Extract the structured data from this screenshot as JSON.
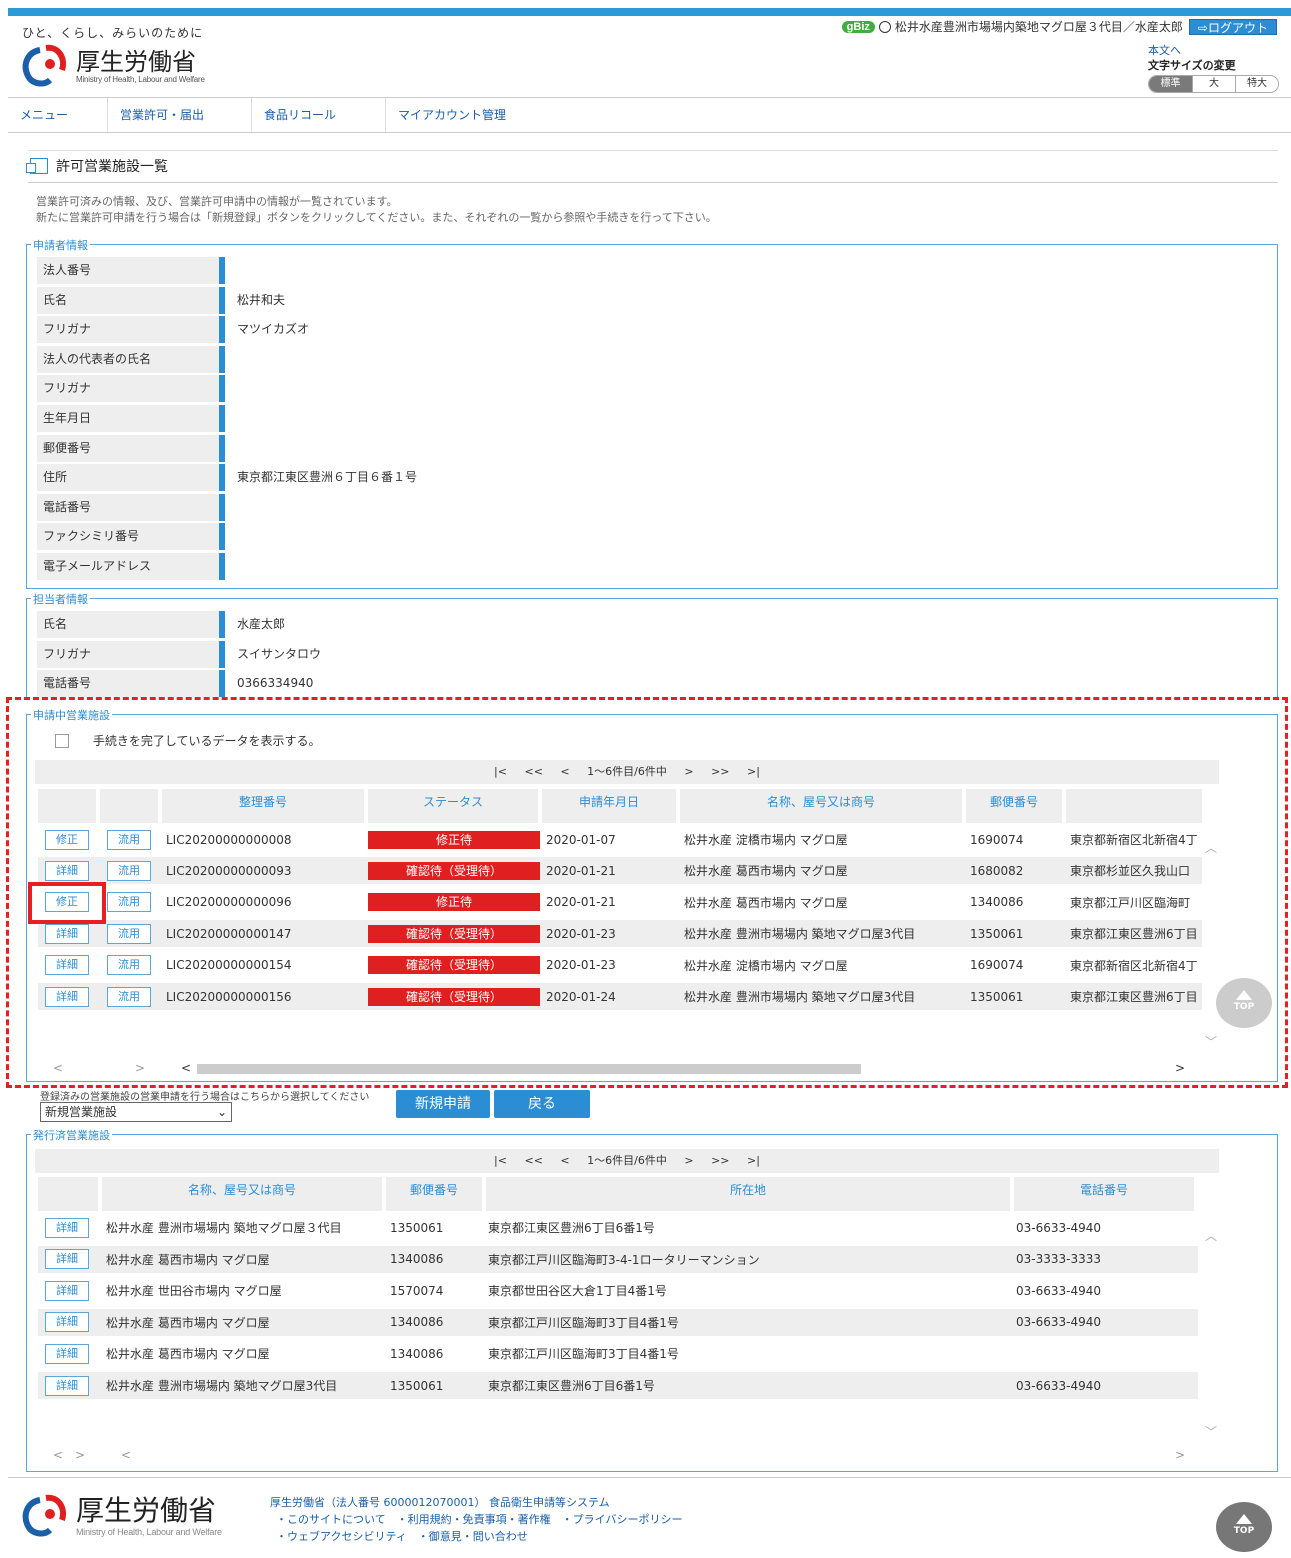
{
  "header": {
    "tagline": "ひと、くらし、みらいのために",
    "logo_ja": "厚生労働省",
    "logo_en": "Ministry of Health, Labour and Welfare",
    "gbiz": "gBiz",
    "user": "松井水産豊洲市場場内築地マグロ屋３代目／水産太郎",
    "logout": "ログアウト",
    "skip": "本文へ",
    "fontsize_label": "文字サイズの変更",
    "fontsize": [
      "標準",
      "大",
      "特大"
    ]
  },
  "nav": [
    "メニュー",
    "営業許可・届出",
    "食品リコール",
    "マイアカウント管理"
  ],
  "page": {
    "title": "許可営業施設一覧",
    "desc1": "営業許可済みの情報、及び、営業許可申請中の情報が一覧されています。",
    "desc2": "新たに営業許可申請を行う場合は「新規登録」ボタンをクリックしてください。また、それぞれの一覧から参照や手続きを行って下さい。"
  },
  "applicant": {
    "legend": "申請者情報",
    "rows": [
      {
        "label": "法人番号",
        "value": ""
      },
      {
        "label": "氏名",
        "value": "松井和夫"
      },
      {
        "label": "フリガナ",
        "value": "マツイカズオ"
      },
      {
        "label": "法人の代表者の氏名",
        "value": ""
      },
      {
        "label": "フリガナ",
        "value": ""
      },
      {
        "label": "生年月日",
        "value": ""
      },
      {
        "label": "郵便番号",
        "value": ""
      },
      {
        "label": "住所",
        "value": "東京都江東区豊洲６丁目６番１号"
      },
      {
        "label": "電話番号",
        "value": ""
      },
      {
        "label": "ファクシミリ番号",
        "value": ""
      },
      {
        "label": "電子メールアドレス",
        "value": ""
      }
    ]
  },
  "contact": {
    "legend": "担当者情報",
    "rows": [
      {
        "label": "氏名",
        "value": "水産太郎"
      },
      {
        "label": "フリガナ",
        "value": "スイサンタロウ"
      },
      {
        "label": "電話番号",
        "value": "0366334940"
      }
    ]
  },
  "pending": {
    "legend": "申請中営業施設",
    "checkbox_label": "手続きを完了しているデータを表示する。",
    "pager": [
      "|<",
      "<<",
      "<",
      "1〜6件目/6件中",
      ">",
      ">>",
      ">|"
    ],
    "headers": [
      "",
      "",
      "整理番号",
      "ステータス",
      "申請年月日",
      "名称、屋号又は商号",
      "郵便番号",
      ""
    ],
    "rows": [
      {
        "btn1": "修正",
        "btn2": "流用",
        "no": "LIC20200000000008",
        "status": "修正待",
        "date": "2020-01-07",
        "name": "松井水産 淀橋市場内 マグロ屋",
        "zip": "1690074",
        "addr": "東京都新宿区北新宿4丁"
      },
      {
        "btn1": "詳細",
        "btn2": "流用",
        "no": "LIC20200000000093",
        "status": "確認待（受理待）",
        "date": "2020-01-21",
        "name": "松井水産 葛西市場内 マグロ屋",
        "zip": "1680082",
        "addr": "東京都杉並区久我山口"
      },
      {
        "btn1": "修正",
        "btn2": "流用",
        "no": "LIC20200000000096",
        "status": "修正待",
        "date": "2020-01-21",
        "name": "松井水産 葛西市場内 マグロ屋",
        "zip": "1340086",
        "addr": "東京都江戸川区臨海町"
      },
      {
        "btn1": "詳細",
        "btn2": "流用",
        "no": "LIC20200000000147",
        "status": "確認待（受理待）",
        "date": "2020-01-23",
        "name": "松井水産 豊洲市場場内 築地マグロ屋3代目",
        "zip": "1350061",
        "addr": "東京都江東区豊洲6丁目"
      },
      {
        "btn1": "詳細",
        "btn2": "流用",
        "no": "LIC20200000000154",
        "status": "確認待（受理待）",
        "date": "2020-01-23",
        "name": "松井水産 淀橋市場内 マグロ屋",
        "zip": "1690074",
        "addr": "東京都新宿区北新宿4丁"
      },
      {
        "btn1": "詳細",
        "btn2": "流用",
        "no": "LIC20200000000156",
        "status": "確認待（受理待）",
        "date": "2020-01-24",
        "name": "松井水産 豊洲市場場内 築地マグロ屋3代目",
        "zip": "1350061",
        "addr": "東京都江東区豊洲6丁目"
      }
    ]
  },
  "actions": {
    "select_label": "登録済みの営業施設の営業申請を行う場合はこちらから選択してください",
    "select_value": "新規営業施設",
    "new_button": "新規申請",
    "back_button": "戻る",
    "top": "TOP"
  },
  "issued": {
    "legend": "発行済営業施設",
    "pager": [
      "|<",
      "<<",
      "<",
      "1〜6件目/6件中",
      ">",
      ">>",
      ">|"
    ],
    "headers": [
      "",
      "名称、屋号又は商号",
      "郵便番号",
      "所在地",
      "電話番号"
    ],
    "rows": [
      {
        "btn": "詳細",
        "name": "松井水産 豊洲市場場内 築地マグロ屋３代目",
        "zip": "1350061",
        "addr": "東京都江東区豊洲6丁目6番1号",
        "tel": "03-6633-4940"
      },
      {
        "btn": "詳細",
        "name": "松井水産 葛西市場内 マグロ屋",
        "zip": "1340086",
        "addr": "東京都江戸川区臨海町3-4-1ロータリーマンション",
        "tel": "03-3333-3333"
      },
      {
        "btn": "詳細",
        "name": "松井水産 世田谷市場内 マグロ屋",
        "zip": "1570074",
        "addr": "東京都世田谷区大倉1丁目4番1号",
        "tel": "03-6633-4940"
      },
      {
        "btn": "詳細",
        "name": "松井水産 葛西市場内 マグロ屋",
        "zip": "1340086",
        "addr": "東京都江戸川区臨海町3丁目4番1号",
        "tel": "03-6633-4940"
      },
      {
        "btn": "詳細",
        "name": "松井水産 葛西市場内 マグロ屋",
        "zip": "1340086",
        "addr": "東京都江戸川区臨海町3丁目4番1号",
        "tel": ""
      },
      {
        "btn": "詳細",
        "name": "松井水産 豊洲市場場内 築地マグロ屋3代目",
        "zip": "1350061",
        "addr": "東京都江東区豊洲6丁目6番1号",
        "tel": "03-6633-4940"
      }
    ]
  },
  "footer": {
    "line1": "厚生労働省（法人番号 6000012070001） 食品衛生申請等システム",
    "line2": "・このサイトについて　・利用規約・免責事項・著作権　・プライバシーポリシー",
    "line3": "・ウェブアクセシビリティ　・御意見・問い合わせ"
  },
  "colors": {
    "accent": "#2b8ed4",
    "status_red": "#e02020",
    "highlight_red": "#e62020",
    "gbiz_green": "#3fae3f"
  }
}
